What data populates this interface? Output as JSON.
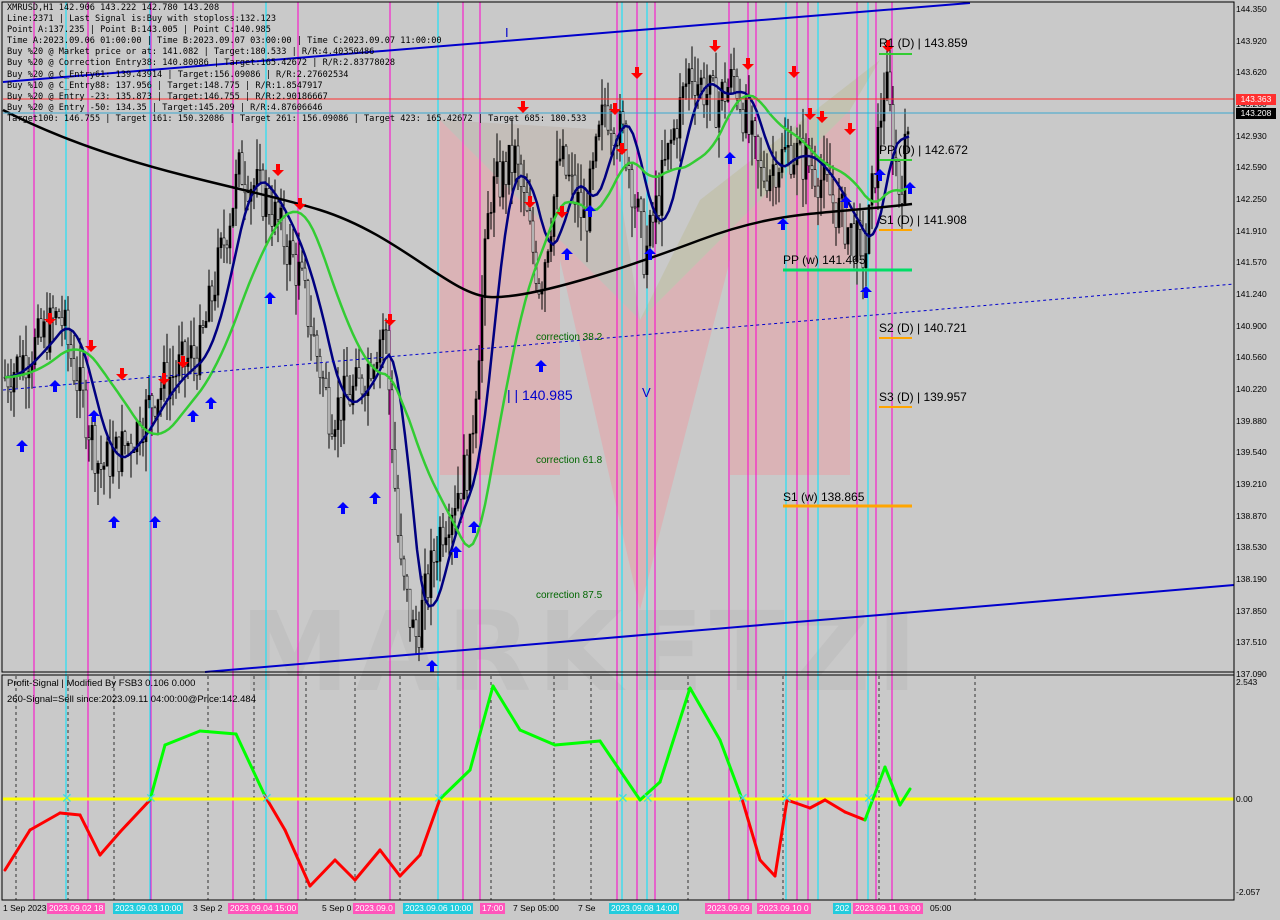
{
  "symbol_header": "XMRUSD,H1  142.906 143.222 142.780 143.208",
  "info_lines": [
    "Line:2371 | Last Signal is:Buy with stoploss:132.123",
    "Point A:137.235 | Point B:143.005 | Point C:140.985",
    "Time A:2023.09.06 01:00:00 | Time B:2023.09.07 03:00:00 | Time C:2023.09.07 11:00:00",
    "Buy %20 @ Market price or at: 141.082 | Target:180.533 | R/R:4.40350486",
    "Buy %20 @ Correction Entry38: 140.80086 | Target:165.42672 | R/R:2.83778028",
    "Buy %20 @ C_Entry61: 139.43914 | Target:156.09086 | R/R:2.27602534",
    "Buy %10 @ C_Entry88: 137.956 | Target:148.775 | R/R:1.8547917",
    "Buy %20 @ Entry -23: 135.873 | Target:146.755 | R/R:2.90186667",
    "Buy %20 @ Entry -50: 134.35 | Target:145.209 | R/R:4.87606646",
    "Target100: 146.755 | Target 161: 150.32086 | Target 261: 156.09086 | Target 423: 165.42672 | Target 685: 180.533"
  ],
  "indicator_header": "Profit-Signal | Modified By FSB3 0.106 0.000",
  "indicator_signal": "260-Signal=Sell since:2023.09.11 04:00:00@Price:142.484",
  "price_axis": [
    "144.350",
    "143.990",
    "143.620",
    "143.280",
    "142.930",
    "142.590",
    "142.250",
    "141.910",
    "141.570",
    "141.240",
    "140.900",
    "140.560",
    "140.220",
    "139.880",
    "139.540",
    "139.210",
    "138.870",
    "138.530",
    "138.190",
    "137.850",
    "137.510",
    "137.180"
  ],
  "price_axis_display": [
    "144.350",
    "143.920",
    "143.620",
    "143.260",
    "142.930",
    "142.590",
    "142.250",
    "141.910",
    "141.570",
    "141.240",
    "140.900",
    "140.560",
    "140.220",
    "139.880",
    "139.540",
    "139.210",
    "138.870",
    "138.530",
    "138.190",
    "137.850",
    "137.510",
    "137.090"
  ],
  "current_price_tag": "143.208",
  "stoploss_price_tag": "143.363",
  "indicator_axis": [
    "2.543",
    "0.00",
    "-2.057"
  ],
  "time_axis": [
    "1 Sep 2023",
    "3 Sep 2",
    "5 Sep 0",
    "7 Sep 05:00",
    "7 Se",
    "05:00"
  ],
  "time_boxes": [
    "2023.09.02 18",
    "2023.09.03 10:00",
    "2023.09.04 15:00",
    "2023.09.0",
    "2023.09.06 10:00",
    "17:00",
    "2023.09.08 14:00",
    "2023.09.09",
    "2023.09.10 0",
    "202",
    "2023.09.11 03:00"
  ],
  "levels": {
    "r1d": "R1 (D) | 143.859",
    "ppd": "PP (D) | 142.672",
    "s1d": "S1 (D) | 141.908",
    "s2d": "S2 (D) | 140.721",
    "s3d": "S3 (D) | 139.957",
    "ppw": "PP (w)  141.465",
    "s1w": "S1 (w)  138.865"
  },
  "annotations": {
    "corr38": "correction 38.2",
    "corr61": "correction 61.8",
    "corr87": "correction 87.5",
    "pointC": "| | 140.985",
    "labelI": "I",
    "labelV": "V"
  },
  "colors": {
    "bg": "#c9c9c9",
    "ma_green": "#33cc33",
    "ma_navy": "#000080",
    "ma_black": "#000000",
    "channel": "#0000cc",
    "vline_pink": "#ff00cc",
    "vline_cyan": "#00e5ff",
    "signal_green": "#00ff00",
    "signal_red": "#ff0000",
    "zero_line": "#ffff00",
    "up_arrow": "#0000ff",
    "down_arrow": "#ff0000"
  },
  "chart_data": {
    "type": "candlestick",
    "symbol": "XMRUSD",
    "timeframe": "H1",
    "ohlc_last": {
      "open": 142.906,
      "high": 143.222,
      "low": 142.78,
      "close": 143.208
    },
    "ylim": [
      137.09,
      144.35
    ],
    "pivots": {
      "R1_D": 143.859,
      "PP_D": 142.672,
      "S1_D": 141.908,
      "S2_D": 140.721,
      "S3_D": 139.957,
      "PP_W": 141.465,
      "S1_W": 138.865
    },
    "points": {
      "A": 137.235,
      "B": 143.005,
      "C": 140.985
    },
    "indicator": {
      "name": "Profit-Signal",
      "ylim": [
        -2.057,
        2.543
      ]
    }
  }
}
